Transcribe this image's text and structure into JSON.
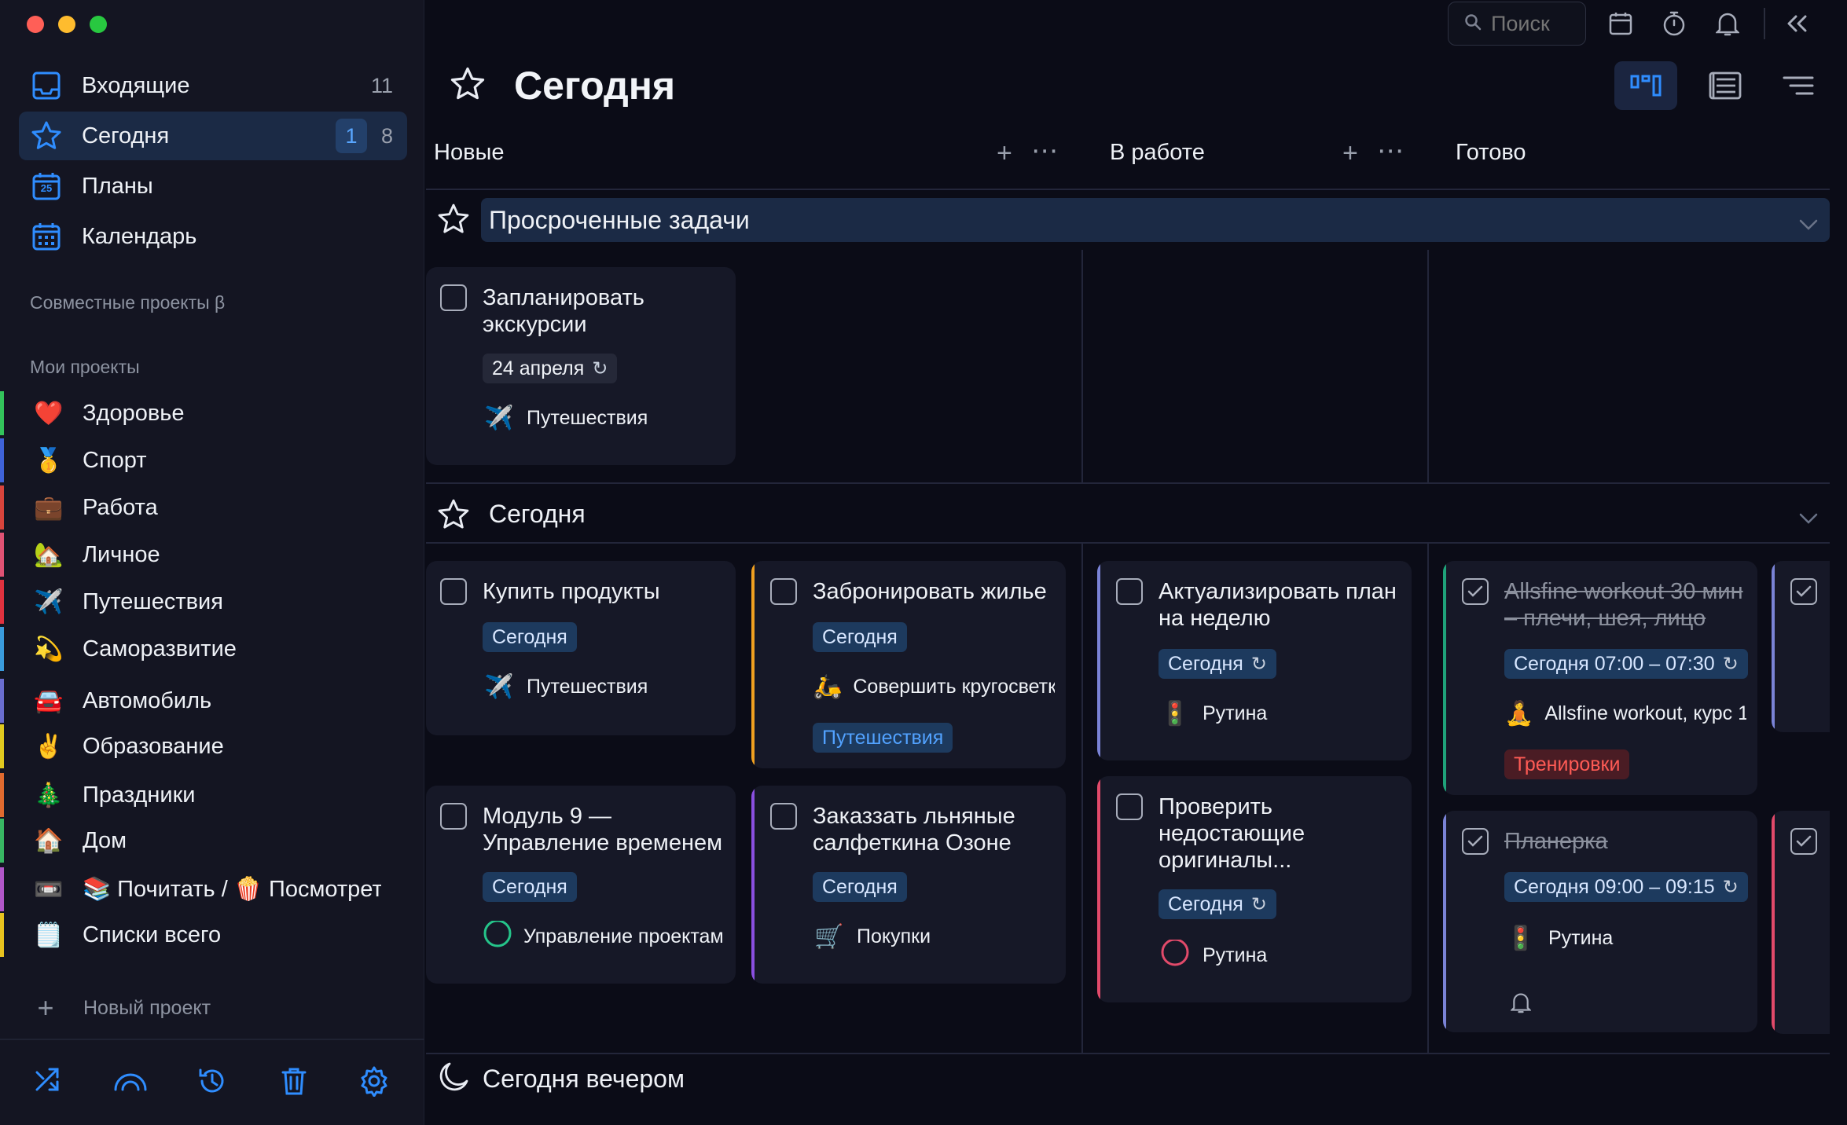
{
  "sidebar": {
    "nav": [
      {
        "label": "Входящие",
        "count": "11"
      },
      {
        "label": "Сегодня",
        "count_badge": "1",
        "count": "8"
      },
      {
        "label": "Планы",
        "icon_text": "25"
      },
      {
        "label": "Календарь"
      }
    ],
    "shared_projects_label": "Совместные проекты β",
    "my_projects_label": "Мои проекты",
    "projects": [
      {
        "emoji": "❤️",
        "label": "Здоровье",
        "color": "#33c35b"
      },
      {
        "emoji": "🥇",
        "label": "Спорт",
        "color": "#3f62d8"
      },
      {
        "emoji": "💼",
        "label": "Работа",
        "color": "#d8443c"
      },
      {
        "emoji": "🏡",
        "label": "Личное",
        "color": "#e05274"
      },
      {
        "emoji": "✈️",
        "label": "Путешествия",
        "color": "#e0323f"
      },
      {
        "emoji": "💫",
        "label": "Саморазвитие",
        "color": "#3a9bdc"
      },
      {
        "emoji": "🚘",
        "label": "Автомобиль",
        "color": "#6a6dcf"
      },
      {
        "emoji": "✌️",
        "label": "Образование",
        "color": "#e1c91f"
      },
      {
        "emoji": "🎄",
        "label": "Праздники",
        "color": "#e06a2f"
      },
      {
        "emoji": "🏠",
        "label": "Дом",
        "color": "#38b763"
      },
      {
        "emoji": "📼",
        "label": "📚 Почитать / 🍿 Посмотреть",
        "color": "#b157c9"
      },
      {
        "emoji": "🗒️",
        "label": "Списки всего",
        "color": "#e8c31f"
      }
    ],
    "new_project_label": "Новый проект"
  },
  "topbar": {
    "search_placeholder": "Поиск"
  },
  "page": {
    "title": "Сегодня"
  },
  "columns": [
    {
      "label": "Новые"
    },
    {
      "label": "В работе"
    },
    {
      "label": "Готово"
    }
  ],
  "sections": {
    "overdue": "Просроченные задачи",
    "today": "Сегодня",
    "evening": "Сегодня вечером"
  },
  "cards": {
    "overdue_new": [
      {
        "title": "Запланировать экскурсии",
        "chip": "24 апреля",
        "meta_emoji": "✈️",
        "meta": "Путешествия"
      }
    ],
    "today_new_a": [
      {
        "title": "Купить продукты",
        "chip": "Сегодня",
        "meta_emoji": "✈️",
        "meta": "Путешествия"
      },
      {
        "title": "Модуль 9 — Управление временем",
        "chip": "Сегодня",
        "meta": "Управление проектами"
      }
    ],
    "today_new_b": [
      {
        "title": "Забронировать жилье",
        "chip": "Сегодня",
        "meta_emoji": "🛵",
        "meta": "Совершить кругосветку",
        "tag": "Путешествия"
      },
      {
        "title": "Заказзать льняные салфеткина Озоне",
        "chip": "Сегодня",
        "meta_emoji": "🛒",
        "meta": "Покупки"
      }
    ],
    "today_work": [
      {
        "title": "Актуализировать план на неделю",
        "chip": "Сегодня",
        "meta_emoji": "🚦",
        "meta": "Рутина"
      },
      {
        "title": "Проверить недостающие оригиналы...",
        "chip": "Сегодня",
        "meta": "Рутина"
      }
    ],
    "today_done": [
      {
        "title": "Allsfine workout 30 мин – плечи, шея, лицо",
        "chip": "Сегодня 07:00 – 07:30",
        "meta_emoji": "🧘",
        "meta": "Allsfine workout, курс 1",
        "tag": "Тренировки"
      },
      {
        "title": "Планерка",
        "chip": "Сегодня 09:00 – 09:15",
        "meta_emoji": "🚦",
        "meta": "Рутина"
      }
    ]
  },
  "colors": {
    "accent": "#2f8dff",
    "bg": "#0b0c17",
    "sidebar": "#141522",
    "section_bar": "#1b2a45"
  }
}
